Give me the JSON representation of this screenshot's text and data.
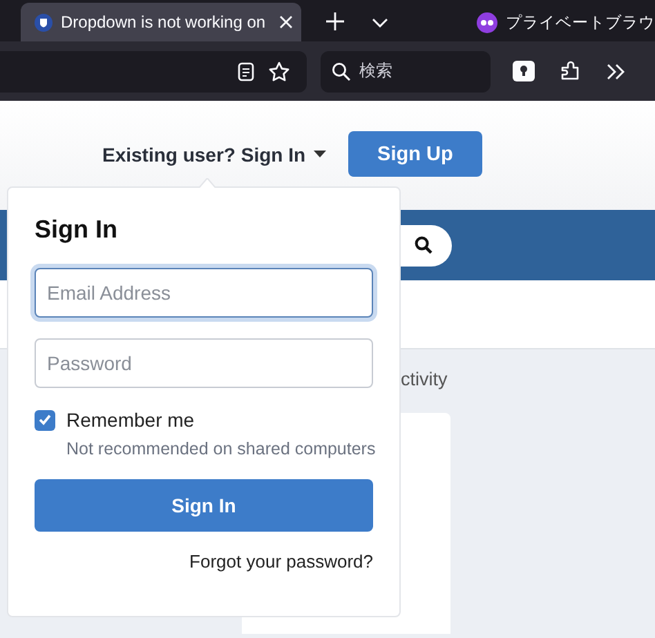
{
  "browser": {
    "tab": {
      "title": "Dropdown is not working on",
      "selected": true
    },
    "private_label": "プライベートブラウ",
    "search": {
      "placeholder": "検索"
    }
  },
  "header": {
    "signin_toggle": "Existing user? Sign In",
    "expanded": true,
    "signup_button": "Sign Up"
  },
  "content": {
    "tab_fragment": "ctivity"
  },
  "popup": {
    "title": "Sign In",
    "fields": [
      {
        "placeholder": "Email Address",
        "focused": true
      },
      {
        "placeholder": "Password",
        "focused": false
      }
    ],
    "remember": {
      "label": "Remember me",
      "checked": true,
      "hint": "Not recommended on shared computers"
    },
    "submit": "Sign In",
    "forgot_link": "Forgot your password?"
  }
}
